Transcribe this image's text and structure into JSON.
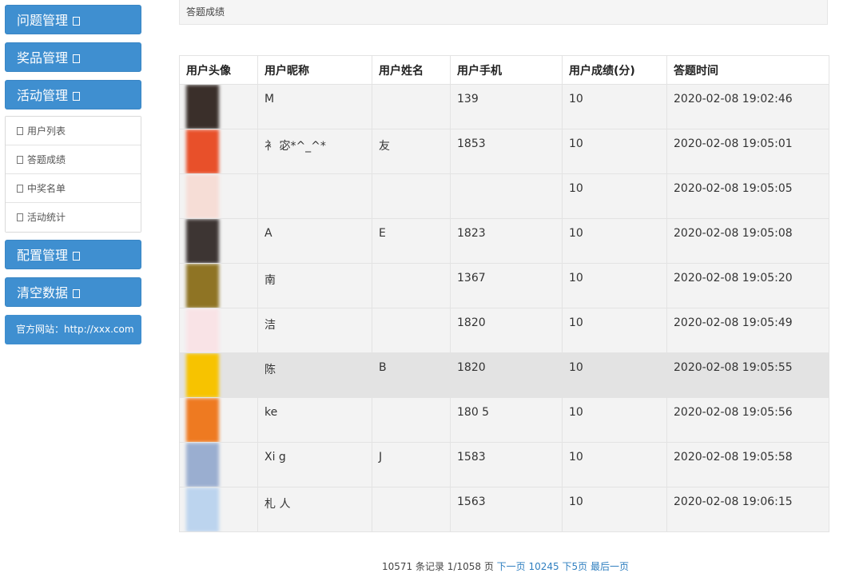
{
  "sidebar": {
    "menus": [
      {
        "label": "问题管理"
      },
      {
        "label": "奖品管理"
      },
      {
        "label": "活动管理"
      }
    ],
    "sub_items": [
      {
        "label": "用户列表"
      },
      {
        "label": "答题成绩"
      },
      {
        "label": "中奖名单"
      },
      {
        "label": "活动统计"
      }
    ],
    "menus_after": [
      {
        "label": "配置管理"
      },
      {
        "label": "清空数据"
      }
    ],
    "official_site": "官方网站：http://xxx.com"
  },
  "breadcrumb": "答题成绩",
  "table": {
    "headers": [
      "用户头像",
      "用户昵称",
      "用户姓名",
      "用户手机",
      "用户成绩(分)",
      "答题时间"
    ],
    "rows": [
      {
        "nickname": "M",
        "name": "",
        "phone": "139",
        "score": "10",
        "time": "2020-02-08 19:02:46",
        "avatar_color": "#3a2f2a"
      },
      {
        "nickname": "衤 宓*^_^*",
        "name": "友",
        "phone": "1853",
        "score": "10",
        "time": "2020-02-08 19:05:01",
        "avatar_color": "#e8502a"
      },
      {
        "nickname": "",
        "name": "",
        "phone": "",
        "score": "10",
        "time": "2020-02-08 19:05:05",
        "avatar_color": "#f6ddd6"
      },
      {
        "nickname": "A",
        "name": "E",
        "phone": "1823",
        "score": "10",
        "time": "2020-02-08 19:05:08",
        "avatar_color": "#3d3533"
      },
      {
        "nickname": "南",
        "name": "",
        "phone": "1367",
        "score": "10",
        "time": "2020-02-08 19:05:20",
        "avatar_color": "#8f7424"
      },
      {
        "nickname": "洁",
        "name": "",
        "phone": "1820",
        "score": "10",
        "time": "2020-02-08 19:05:49",
        "avatar_color": "#f9e3e6"
      },
      {
        "nickname": "陈",
        "name": "B",
        "phone": "1820",
        "score": "10",
        "time": "2020-02-08 19:05:55",
        "avatar_color": "#f7c300"
      },
      {
        "nickname": "ke",
        "name": "",
        "phone": "180 5",
        "score": "10",
        "time": "2020-02-08 19:05:56",
        "avatar_color": "#ee7a21"
      },
      {
        "nickname": "Xi g",
        "name": "J",
        "phone": "1583",
        "score": "10",
        "time": "2020-02-08 19:05:58",
        "avatar_color": "#9aaed0"
      },
      {
        "nickname": "札 人",
        "name": "",
        "phone": "1563",
        "score": "10",
        "time": "2020-02-08 19:06:15",
        "avatar_color": "#bcd4ee"
      }
    ],
    "highlight_row": 6
  },
  "pagination": {
    "summary": "10571 条记录 1/1058 页",
    "links": [
      "下一页",
      "10245",
      "下5页",
      "最后一页"
    ]
  }
}
